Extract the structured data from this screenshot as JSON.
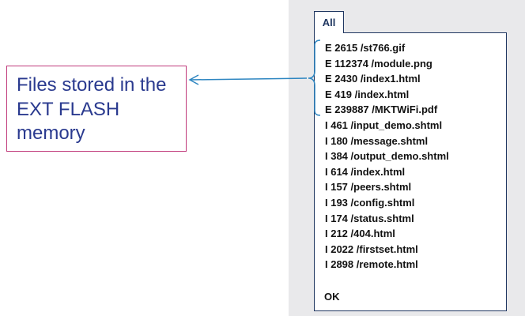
{
  "tab": {
    "label": "All"
  },
  "file_list": [
    "E 2615 /st766.gif",
    "E 112374 /module.png",
    "E 2430 /index1.html",
    "E 419 /index.html",
    "E 239887 /MKTWiFi.pdf",
    "I 461 /input_demo.shtml",
    "I 180 /message.shtml",
    "I 384 /output_demo.shtml",
    "I 614 /index.html",
    "I 157 /peers.shtml",
    "I 193 /config.shtml",
    "I 174 /status.shtml",
    "I 212 /404.html",
    "I 2022 /firstset.html",
    "I 2898 /remote.html"
  ],
  "ok_label": "OK",
  "callout": {
    "text": "Files stored in the EXT FLASH memory"
  },
  "colors": {
    "accent": "#1f3660",
    "annotation": "#2e86c1",
    "callout_border": "#c0397a",
    "callout_text": "#2a3a8f",
    "panel": "#e9e9eb"
  }
}
